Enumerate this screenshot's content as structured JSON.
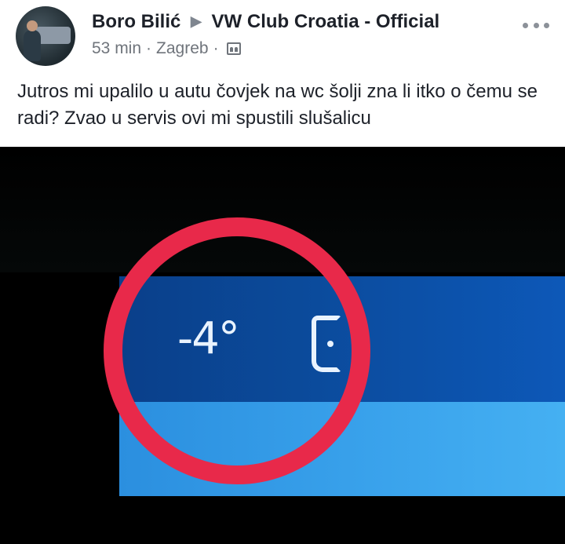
{
  "post": {
    "author": "Boro Bilić",
    "arrow": "▶",
    "group": "VW Club Croatia - Official",
    "time": "53 min",
    "dot": "·",
    "location": "Zagreb",
    "text": "Jutros mi upalilo u autu čovjek na wc šolji zna li itko o čemu se radi?  Zvao u servis ovi mi spustili slušalicu"
  },
  "photo": {
    "temperature": "-4°",
    "highlight_color": "#e8294a"
  },
  "icons": {
    "more": "more-options-icon",
    "audience": "group-audience-icon",
    "lock": "door-lock-icon"
  }
}
